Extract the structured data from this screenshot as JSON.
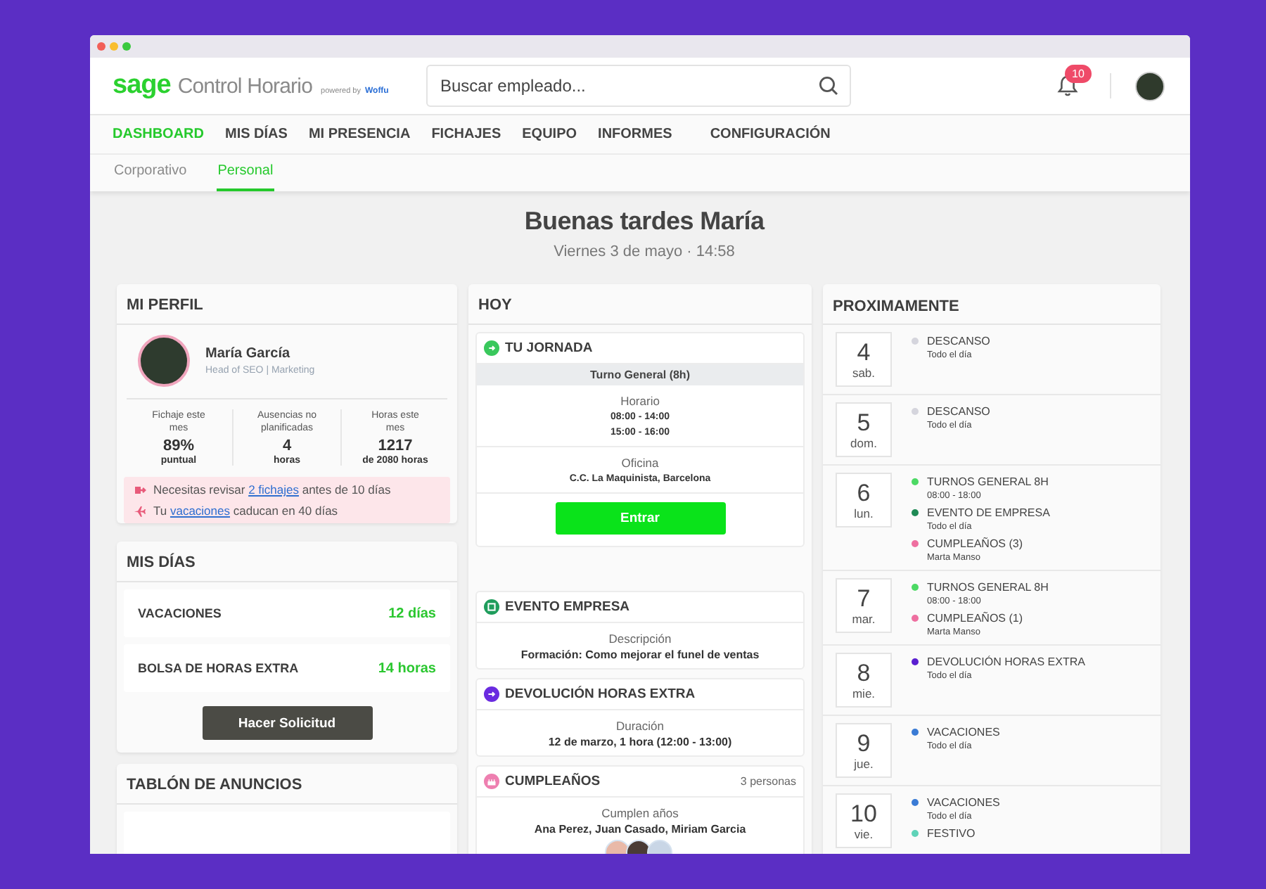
{
  "header": {
    "logo": "sage",
    "app_name": "Control Horario",
    "powered_by": "powered by",
    "partner": "Woffu",
    "search": {
      "placeholder": "Buscar empleado..."
    },
    "notifications": "10"
  },
  "nav": [
    {
      "label": "DASHBOARD",
      "selected": true
    },
    {
      "label": "MIS DÍAS",
      "selected": false
    },
    {
      "label": "MI PRESENCIA",
      "selected": false
    },
    {
      "label": "FICHAJES",
      "selected": false
    },
    {
      "label": "EQUIPO",
      "selected": false
    },
    {
      "label": "INFORMES",
      "selected": false
    },
    {
      "label": "CONFIGURACIÓN",
      "selected": false
    }
  ],
  "subtabs": [
    {
      "label": "Corporativo",
      "selected": false
    },
    {
      "label": "Personal",
      "selected": true
    }
  ],
  "greeting": {
    "title": "Buenas tardes María",
    "date": "Viernes 3 de mayo · 14:58"
  },
  "profile": {
    "title": "MI PERFIL",
    "name": "María García",
    "role": "Head of SEO | Marketing",
    "stats": [
      {
        "label": "Fichaje este mes",
        "value": "89%",
        "unit": "puntual"
      },
      {
        "label": "Ausencias no planificadas",
        "value": "4",
        "unit": "horas"
      },
      {
        "label": "Horas este mes",
        "value": "1217",
        "unit": "de 2080 horas"
      }
    ],
    "alerts": [
      {
        "kind": "review",
        "before": "Necesitas revisar ",
        "link": "2 fichajes",
        "after": " antes de 10 días"
      },
      {
        "kind": "vacation",
        "before": "Tu ",
        "link": "vacaciones",
        "after": " caducan en 40 días"
      }
    ]
  },
  "my_days": {
    "title": "MIS DÍAS",
    "balances": [
      {
        "label": "VACACIONES",
        "value": "12 días"
      },
      {
        "label": "BOLSA DE HORAS EXTRA",
        "value": "14 horas"
      }
    ],
    "button": "Hacer Solicitud"
  },
  "board": {
    "title": "TABLÓN DE ANUNCIOS"
  },
  "today": {
    "title": "HOY",
    "sections": [
      {
        "kind": "shift",
        "title": "TU JORNADA",
        "color": "#39c85c",
        "shift": "Turno General (8h)",
        "details": [
          {
            "label": "Horario",
            "lines": [
              "08:00 - 14:00",
              "15:00 - 16:00"
            ]
          },
          {
            "label": "Oficina",
            "lines": [
              "C.C. La Maquinista, Barcelona"
            ]
          }
        ],
        "button": "Entrar"
      },
      {
        "kind": "info",
        "title": "EVENTO EMPRESA",
        "color": "#1f9d5c",
        "label": "Descripción",
        "value": "Formación: Como mejorar el funel de ventas"
      },
      {
        "kind": "info",
        "title": "DEVOLUCIÓN HORAS EXTRA",
        "color": "#6a2be0",
        "label": "Duración",
        "value": "12 de marzo, 1 hora (12:00 - 13:00)"
      },
      {
        "kind": "birthday",
        "title": "CUMPLEAÑOS",
        "color": "#ee7fb0",
        "count": "3 personas",
        "label": "Cumplen años",
        "value": "Ana Perez, Juan Casado, Miriam Garcia"
      }
    ]
  },
  "upcoming": {
    "title": "PROXIMAMENTE",
    "days": [
      {
        "day": "4",
        "weekday": "sab.",
        "events": [
          {
            "name": "DESCANSO",
            "time": "Todo el día",
            "color": "#d5d5dd"
          }
        ]
      },
      {
        "day": "5",
        "weekday": "dom.",
        "events": [
          {
            "name": "DESCANSO",
            "time": "Todo el día",
            "color": "#d5d5dd"
          }
        ]
      },
      {
        "day": "6",
        "weekday": "lun.",
        "events": [
          {
            "name": "TURNOS GENERAL 8H",
            "time": "08:00 - 18:00",
            "color": "#4cd964"
          },
          {
            "name": "EVENTO DE EMPRESA",
            "time": "Todo el día",
            "color": "#1e8a55"
          },
          {
            "name": "CUMPLEAÑOS (3)",
            "time": "Marta Manso",
            "color": "#ee6fa0"
          }
        ]
      },
      {
        "day": "7",
        "weekday": "mar.",
        "events": [
          {
            "name": "TURNOS GENERAL 8H",
            "time": "08:00 - 18:00",
            "color": "#4cd964"
          },
          {
            "name": "CUMPLEAÑOS (1)",
            "time": "Marta Manso",
            "color": "#ee6fa0"
          }
        ]
      },
      {
        "day": "8",
        "weekday": "mie.",
        "events": [
          {
            "name": "DEVOLUCIÓN HORAS EXTRA",
            "time": "Todo el día",
            "color": "#5a1fd0"
          }
        ]
      },
      {
        "day": "9",
        "weekday": "jue.",
        "events": [
          {
            "name": "VACACIONES",
            "time": "Todo el día",
            "color": "#3a7bd5"
          }
        ]
      },
      {
        "day": "10",
        "weekday": "vie.",
        "events": [
          {
            "name": "VACACIONES",
            "time": "Todo el día",
            "color": "#3a7bd5"
          },
          {
            "name": "FESTIVO",
            "color": "#5fd3b8"
          }
        ]
      }
    ]
  }
}
